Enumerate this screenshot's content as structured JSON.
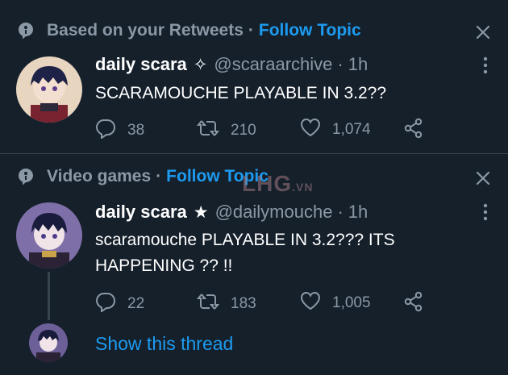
{
  "tweet1": {
    "context": {
      "label": "Based on your Retweets",
      "separator": "·",
      "follow": "Follow Topic"
    },
    "author": {
      "name": "daily scara",
      "badge": "✧",
      "handle": "@scaraarchive",
      "dot": "·",
      "time": "1h"
    },
    "text": "SCARAMOUCHE PLAYABLE IN 3.2??",
    "actions": {
      "replies": "38",
      "retweets": "210",
      "likes": "1,074"
    }
  },
  "tweet2": {
    "context": {
      "label": "Video games",
      "separator": "·",
      "follow": "Follow Topic"
    },
    "author": {
      "name": "daily scara",
      "badge": "★",
      "handle": "@dailymouche",
      "dot": "·",
      "time": "1h"
    },
    "text": "scaramouche PLAYABLE IN 3.2??? ITS HAPPENING ?? !!",
    "actions": {
      "replies": "22",
      "retweets": "183",
      "likes": "1,005"
    },
    "thread_link": "Show this thread"
  },
  "watermark": {
    "main": "LHG",
    "suffix": ".VN"
  },
  "icons": {
    "context": "topic-icon",
    "close": "close-icon",
    "more": "more-icon",
    "reply": "reply-icon",
    "retweet": "retweet-icon",
    "like": "heart-icon",
    "share": "share-icon"
  },
  "colors": {
    "background": "#15202b",
    "link": "#1d9bf0",
    "muted": "#8b98a5",
    "divider": "#38444d"
  }
}
